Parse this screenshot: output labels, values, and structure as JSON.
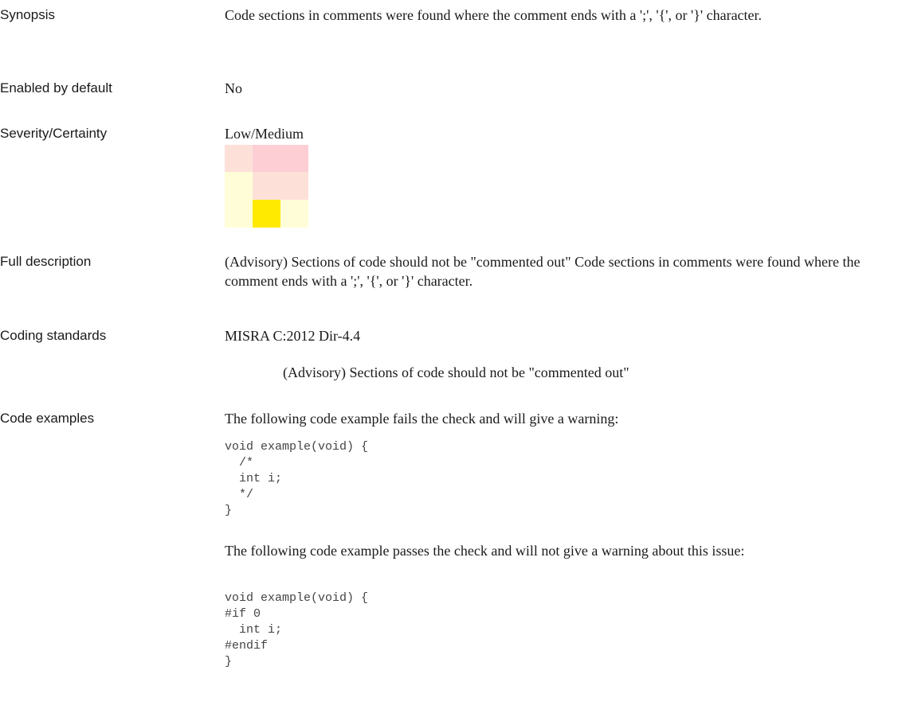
{
  "rows": {
    "synopsis": {
      "label": "Synopsis",
      "text": "Code sections in comments were found where the comment ends with a ';', '{', or '}' character."
    },
    "enabled": {
      "label": "Enabled by default",
      "text": "No"
    },
    "severity": {
      "label": "Severity/Certainty",
      "text": "Low/Medium",
      "grid_colors": [
        [
          "#fde1d9",
          "#fdcfd4",
          "#fdcfd4"
        ],
        [
          "#fffdd8",
          "#fde1d9",
          "#fde1d9"
        ],
        [
          "#fffdd8",
          "#ffea00",
          "#fffdd8"
        ]
      ]
    },
    "full_description": {
      "label": "Full description",
      "text": "(Advisory) Sections of code should not be \"commented out\" Code sections in comments were found where the comment ends with a ';', '{', or '}' character."
    },
    "coding_standards": {
      "label": "Coding standards",
      "standard": "MISRA C:2012 Dir-4.4",
      "detail": "(Advisory) Sections of code should not be \"commented out\""
    },
    "code_examples": {
      "label": "Code examples",
      "fail_intro": "The following code example fails the check and will give a warning:",
      "fail_code": "void example(void) {\n  /*\n  int i;\n  */\n}",
      "pass_intro": "The following code example passes the check and will not give a warning about this issue:",
      "pass_code": "void example(void) {\n#if 0\n  int i;\n#endif\n}"
    }
  }
}
